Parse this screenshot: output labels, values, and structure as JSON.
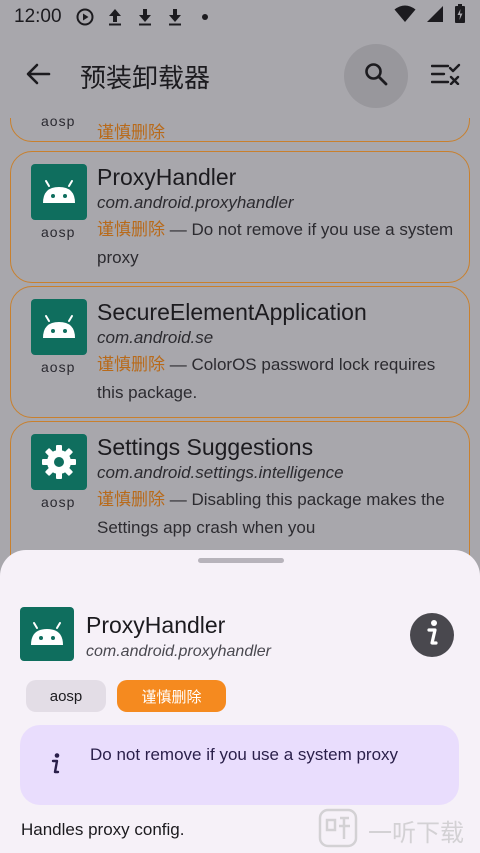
{
  "status_bar": {
    "time": "12:00",
    "icons": [
      "play-circle-icon",
      "upload-icon",
      "download-icon",
      "download-icon",
      "dot-icon",
      "wifi-icon",
      "signal-icon",
      "battery-icon"
    ]
  },
  "app_bar": {
    "title": "预装卸载器",
    "icons": [
      "arrow-back-icon",
      "search-icon",
      "filter-list-icon"
    ]
  },
  "list": {
    "previous_fragment": {
      "repo": "aosp",
      "tag": "谨慎删除"
    },
    "items": [
      {
        "name": "ProxyHandler",
        "package": "com.android.proxyhandler",
        "repo": "aosp",
        "tag": "谨慎删除",
        "separator": " — ",
        "note": "Do not remove if you use a system proxy",
        "icon": "android-icon"
      },
      {
        "name": "SecureElementApplication",
        "package": "com.android.se",
        "repo": "aosp",
        "tag": "谨慎删除",
        "separator": " — ",
        "note": "ColorOS password lock requires this package.",
        "icon": "android-icon"
      },
      {
        "name": "Settings Suggestions",
        "package": "com.android.settings.intelligence",
        "repo": "aosp",
        "tag": "谨慎删除",
        "separator": " — ",
        "note": "Disabling this package makes the Settings app crash when you",
        "icon": "gear-icon"
      }
    ]
  },
  "sheet": {
    "name": "ProxyHandler",
    "package": "com.android.proxyhandler",
    "chips": {
      "repo": "aosp",
      "tag": "谨慎删除"
    },
    "note": "Do not remove if you use a system proxy",
    "description": "Handles proxy config."
  },
  "watermark": {
    "text": "一听下载"
  },
  "colors": {
    "accent_orange": "#f58a1f",
    "tag_text": "#b86a1a",
    "card_border": "#c8802e",
    "icon_green": "#0f6e5e",
    "note_bg": "#e9ddfd",
    "sheet_bg": "#f6f1f8"
  }
}
